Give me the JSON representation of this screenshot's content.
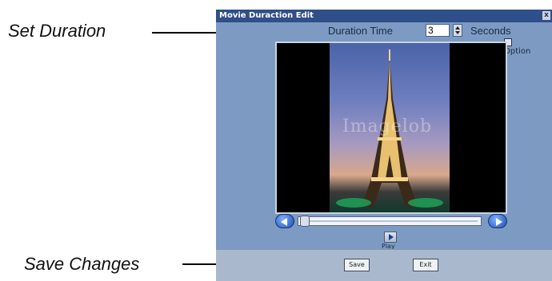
{
  "annotations": {
    "set_duration": "Set Duration",
    "save_changes": "Save Changes"
  },
  "window": {
    "title": "Movie Duraction Edit",
    "close_glyph": "x"
  },
  "duration": {
    "label": "Duration Time",
    "value": "3",
    "unit": "Seconds"
  },
  "option": {
    "label": "Option",
    "checked": false
  },
  "viewer": {
    "watermark": "Imagelob"
  },
  "playback": {
    "play_label": "Play",
    "position": 0.0
  },
  "buttons": {
    "save": "Save",
    "exit": "Exit"
  },
  "colors": {
    "window_bg": "#7d9bc2",
    "titlebar": "#2f4f8a",
    "footer": "#a9b8cc"
  },
  "icons": {
    "prev": "chevron-left-icon",
    "next": "chevron-right-icon",
    "play": "play-icon"
  }
}
